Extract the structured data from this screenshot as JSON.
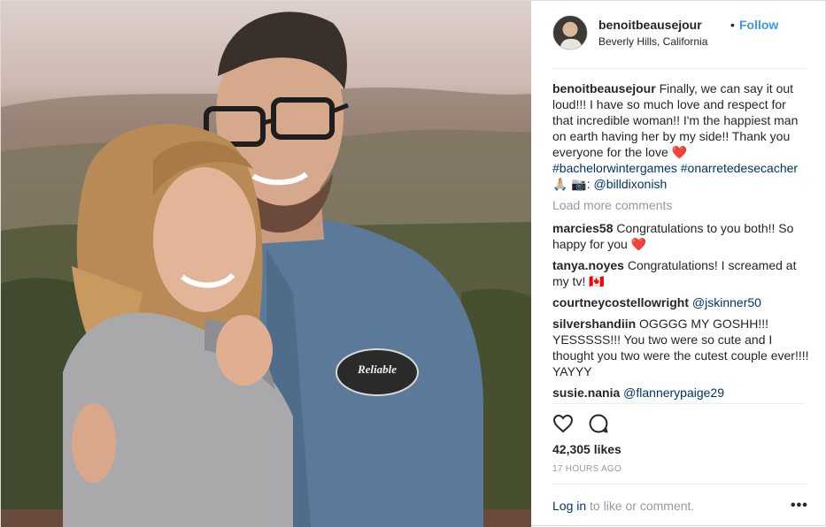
{
  "post": {
    "username": "benoitbeausejour",
    "separator": "•",
    "follow_label": "Follow",
    "location": "Beverly Hills, California",
    "caption": {
      "user": "benoitbeausejour",
      "text": "Finally, we can say it out loud!!! I have so much love and respect for that incredible woman!! I'm the happiest man on earth having her by my side!! Thank you everyone for the love",
      "heart": "❤️",
      "hashtag1": "#bachelorwintergames",
      "hashtag2": "#onarretedesecacher",
      "emoji": "🙏🏼 📷",
      "colon": ":",
      "credit": "@billdixonish"
    },
    "load_more": "Load more comments",
    "comments": [
      {
        "user": "marcies58",
        "text": "Congratulations to you both!! So happy for you",
        "emoji": "❤️"
      },
      {
        "user": "tanya.noyes",
        "text": "Congratulations! I screamed at my tv!",
        "emoji": "🇨🇦"
      },
      {
        "user": "courtneycostellowright",
        "text": "",
        "mention": "@jskinner50"
      },
      {
        "user": "silvershandiin",
        "text": "OGGGG MY GOSHH!!! YESSSSS!!! You two were so cute and I thought you two were the cutest couple ever!!!! YAYYY"
      },
      {
        "user": "susie.nania",
        "text": "",
        "mention": "@flannerypaige29"
      }
    ],
    "likes": "42,305 likes",
    "time": "17 HOURS AGO",
    "login_link": "Log in",
    "login_rest": " to like or comment.",
    "more_label": "•••",
    "patch_text": "Reliable",
    "icons": {
      "like": "heart-icon",
      "comment": "comment-icon"
    },
    "colors": {
      "link": "#003569",
      "follow": "#3897f0",
      "heart": "#ed4956",
      "muted": "#999999"
    }
  }
}
